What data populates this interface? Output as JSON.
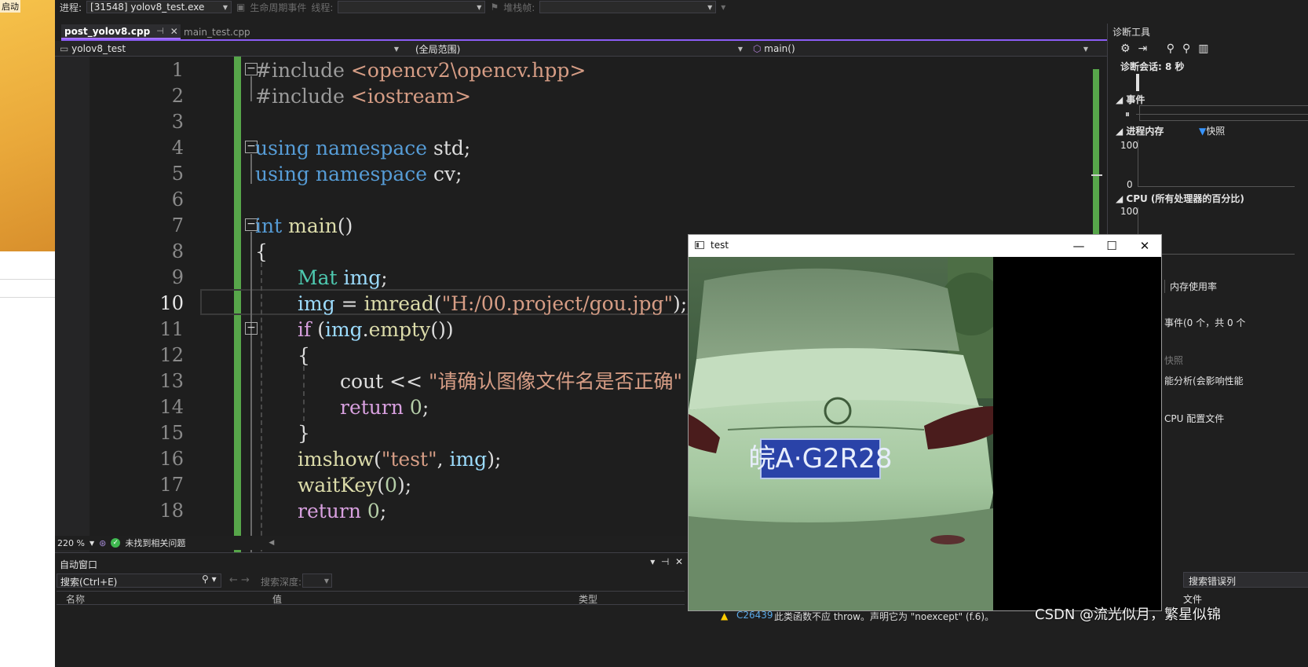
{
  "desktop": {
    "label": "启动"
  },
  "debug_toolbar": {
    "process_label": "进程:",
    "process_value": "[31548] yolov8_test.exe",
    "lifecycle_label": "生命周期事件",
    "thread_label": "线程:",
    "stack_label": "堆栈帧:"
  },
  "tabs": [
    {
      "label": "post_yolov8.cpp",
      "active": true
    },
    {
      "label": "main_test.cpp",
      "active": false
    }
  ],
  "nav": {
    "project": "yolov8_test",
    "scope": "(全局范围)",
    "member": "main()"
  },
  "editor": {
    "current_line": 10,
    "lines": [
      {
        "n": "1",
        "t": "#include <opencv2\\opencv.hpp>"
      },
      {
        "n": "2",
        "t": "#include <iostream>"
      },
      {
        "n": "3",
        "t": ""
      },
      {
        "n": "4",
        "t": "using namespace std;"
      },
      {
        "n": "5",
        "t": "using namespace cv;"
      },
      {
        "n": "6",
        "t": ""
      },
      {
        "n": "7",
        "t": "int main()"
      },
      {
        "n": "8",
        "t": "{"
      },
      {
        "n": "9",
        "t": "Mat img;"
      },
      {
        "n": "10",
        "t": "img = imread(\"H:/00.project/gou.jpg\");"
      },
      {
        "n": "11",
        "t": "if (img.empty())"
      },
      {
        "n": "12",
        "t": "{"
      },
      {
        "n": "13",
        "t": "cout << \"请确认图像文件名是否正确\" << "
      },
      {
        "n": "14",
        "t": "return 0;"
      },
      {
        "n": "15",
        "t": "}"
      },
      {
        "n": "16",
        "t": "imshow(\"test\", img);"
      },
      {
        "n": "17",
        "t": "waitKey(0);"
      },
      {
        "n": "18",
        "t": "return 0;"
      }
    ]
  },
  "editor_status": {
    "zoom": "220 %",
    "issues": "未找到相关问题"
  },
  "autos": {
    "title": "自动窗口",
    "search_placeholder": "搜索(Ctrl+E)",
    "depth_label": "搜索深度:",
    "columns": [
      "名称",
      "值",
      "类型"
    ]
  },
  "diagnostics": {
    "title": "诊断工具",
    "session": "诊断会话: 8 秒",
    "events": "事件",
    "process_memory": "进程内存",
    "snapshot": "快照",
    "mem_max": "100",
    "mem_min": "0",
    "cpu": "CPU (所有处理器的百分比)",
    "cpu_max": "100",
    "memory_usage_tab": "内存使用率",
    "events_count": "事件(0 个，共 0 个",
    "snapshot_item": "快照",
    "perf_analysis": "能分析(会影响性能",
    "cpu_profile": "CPU 配置文件",
    "search_errors": "搜索错误列",
    "file_col": "文件"
  },
  "error_list": {
    "code": "C26439",
    "message": "此类函数不应 throw。声明它为 \"noexcept\" (f.6)。"
  },
  "test_window": {
    "title": "test",
    "plate": "皖A·G2R28"
  },
  "watermark": "CSDN @流光似月，繁星似锦"
}
